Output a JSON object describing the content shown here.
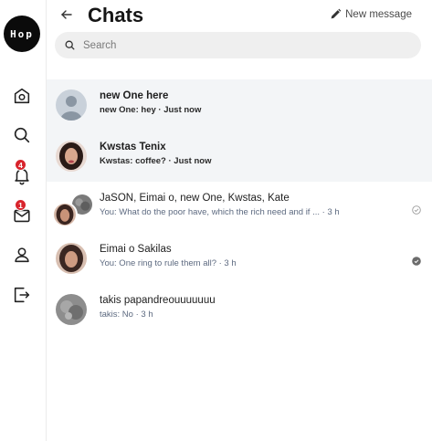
{
  "sidebar": {
    "logo": "Hop",
    "notifications_count": "4",
    "messages_count": "1",
    "items": [
      {
        "name": "home-icon"
      },
      {
        "name": "search-icon"
      },
      {
        "name": "bell-icon"
      },
      {
        "name": "mail-icon"
      },
      {
        "name": "user-icon"
      },
      {
        "name": "logout-icon"
      }
    ]
  },
  "header": {
    "title": "Chats",
    "new_message_label": "New message"
  },
  "search": {
    "placeholder": "Search"
  },
  "chats": [
    {
      "name": "new One here",
      "preview": "new One: hey · Just now",
      "unread": true,
      "avatar": "default"
    },
    {
      "name": "Kwstas Tenix",
      "preview": "Kwstas: coffee? · Just now",
      "unread": true,
      "avatar": "photo-woman"
    },
    {
      "name": "JaSON, Eimai o, new One, Kwstas, Kate",
      "preview": "You: What do the poor have, which the rich need and if ... · 3 h",
      "unread": false,
      "status": "sent"
    },
    {
      "name": "Eimai o Sakilas",
      "preview": "You: One ring to rule them all? · 3 h",
      "unread": false,
      "status": "read"
    },
    {
      "name": "takis papandreouuuuuuu",
      "preview": "takis: No · 3 h",
      "unread": false
    }
  ],
  "colors": {
    "unread_bg": "#f3f5f7",
    "badge": "#d8242c",
    "preview_text": "#5d6a80"
  }
}
